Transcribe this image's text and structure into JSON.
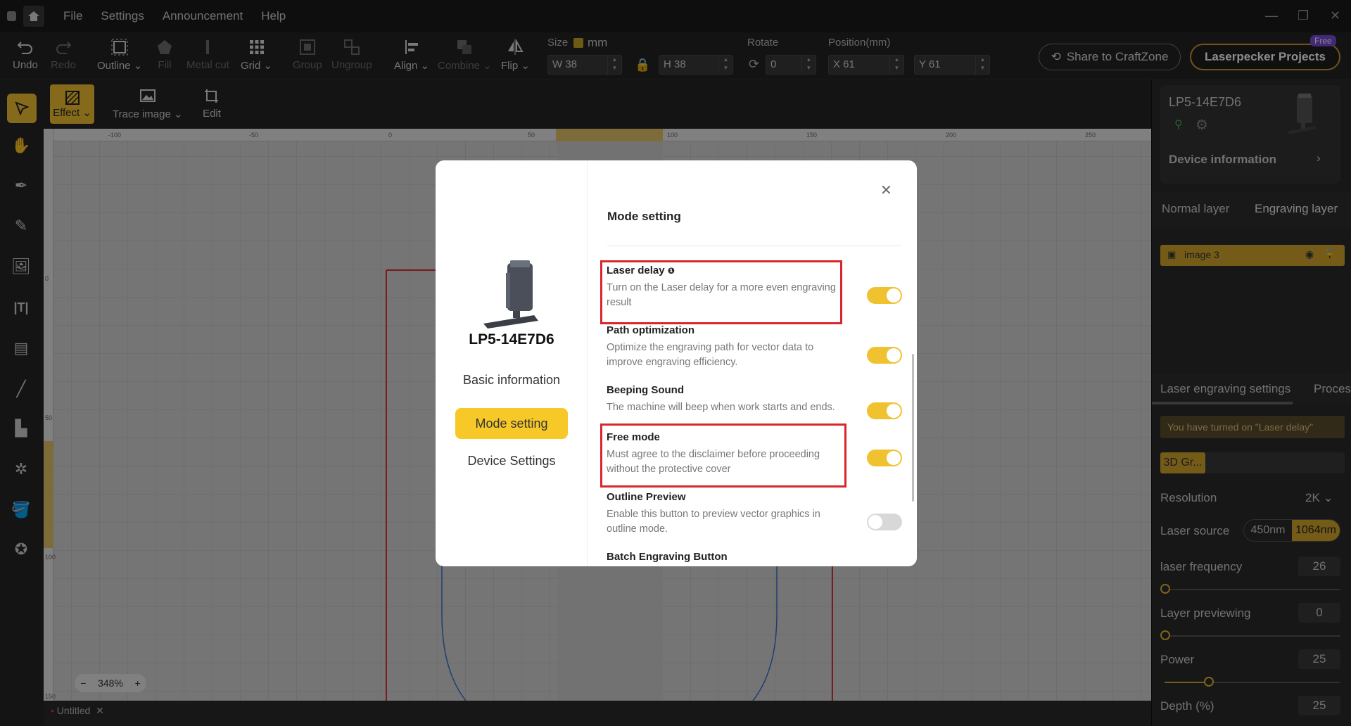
{
  "titlebar": {
    "menus": [
      "File",
      "Settings",
      "Announcement",
      "Help"
    ]
  },
  "toolbar": {
    "undo": "Undo",
    "redo": "Redo",
    "outline": "Outline",
    "fill": "Fill",
    "metal_cut": "Metal cut",
    "grid": "Grid",
    "group": "Group",
    "ungroup": "Ungroup",
    "align": "Align",
    "combine": "Combine",
    "flip": "Flip",
    "size_label": "Size",
    "unit": "mm",
    "width": "W 38",
    "height": "H 38",
    "rotate_label": "Rotate",
    "rotate_value": "0",
    "position_label": "Position(mm)",
    "pos_x": "X 61",
    "pos_y": "Y 61",
    "share_button": "Share to CraftZone",
    "projects_button": "Laserpecker Projects",
    "free_badge": "Free"
  },
  "subbar": {
    "effect": "Effect",
    "trace_image": "Trace image",
    "edit": "Edit"
  },
  "ruler": {
    "top_ticks": [
      "-100",
      "-50",
      "0",
      "50",
      "100",
      "150",
      "200",
      "250"
    ],
    "left_ticks": [
      "0",
      "50",
      "100",
      "150"
    ]
  },
  "zoom": "348%",
  "tab": "Untitled",
  "right_panel": {
    "device_name": "LP5-14E7D6",
    "device_info": "Device information",
    "layer_tabs": [
      "Normal layer",
      "Engraving layer"
    ],
    "layer_item": "image 3",
    "settings_tabs": [
      "Laser engraving settings",
      "Proces"
    ],
    "notice": "You have turned on \"Laser delay\"",
    "mode_chip": "3D Gr...",
    "resolution_label": "Resolution",
    "resolution_value": "2K",
    "laser_source_label": "Laser source",
    "laser_source_options": [
      "450nm",
      "1064nm"
    ],
    "laser_frequency_label": "laser frequency",
    "laser_frequency_value": "26",
    "layer_previewing_label": "Layer previewing",
    "layer_previewing_value": "0",
    "power_label": "Power",
    "power_value": "25",
    "depth_label": "Depth (%)",
    "depth_value": "25"
  },
  "modal": {
    "device_name": "LP5-14E7D6",
    "nav": [
      "Basic information",
      "Mode setting",
      "Device Settings"
    ],
    "title": "Mode setting",
    "settings": [
      {
        "title": "Laser delay",
        "desc": "Turn on the Laser delay for a more even engraving result",
        "on": true
      },
      {
        "title": "Path optimization",
        "desc": "Optimize the engraving path for vector data to improve engraving efficiency.",
        "on": true
      },
      {
        "title": "Beeping Sound",
        "desc": "The machine will beep when work starts and ends.",
        "on": true
      },
      {
        "title": "Free mode",
        "desc": "Must agree to the disclaimer before proceeding without the protective cover",
        "on": true
      },
      {
        "title": "Outline Preview",
        "desc": "Enable this button to preview vector graphics in outline mode.",
        "on": false
      },
      {
        "title": "Batch Engraving Button",
        "desc": "",
        "on": false
      }
    ]
  },
  "colors": {
    "accent": "#f6c928",
    "highlight": "#d9262c",
    "toggle_on": "#f0c230"
  }
}
